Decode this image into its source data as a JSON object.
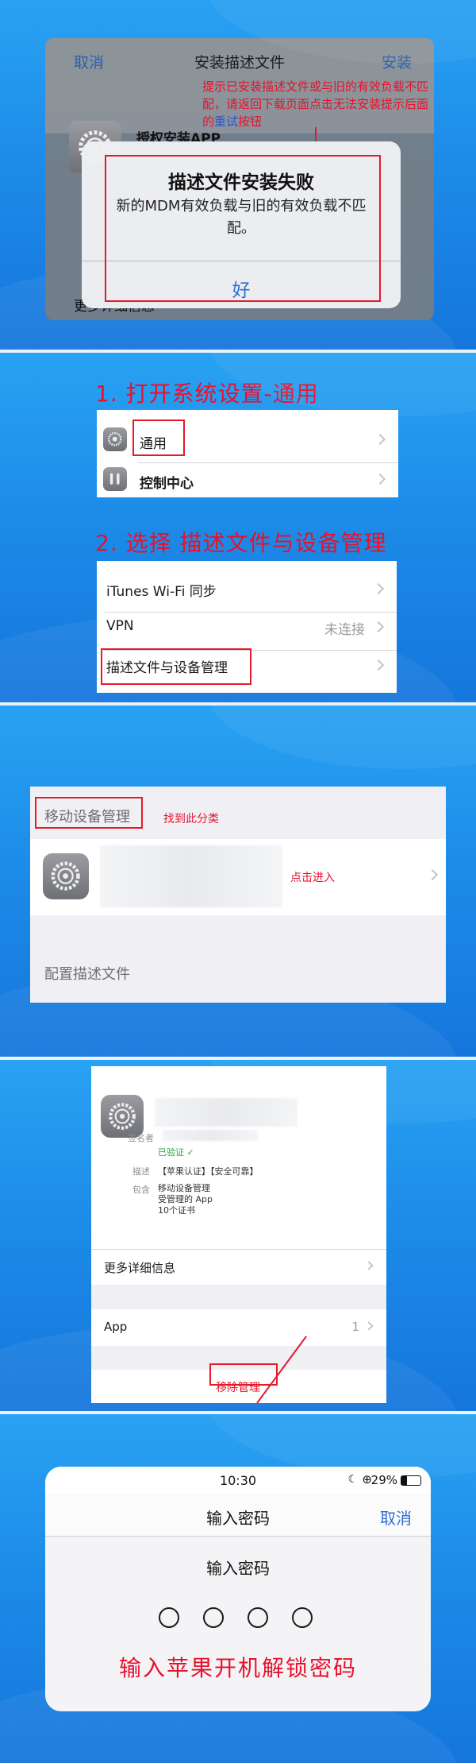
{
  "section1": {
    "cancel": "取消",
    "title": "安装描述文件",
    "install": "安装",
    "app_name": "授权安装APP",
    "more_info_partial": "更多详细信息",
    "note_part1": "提示已安装描述文件或与旧的有效负载不匹配，请返回下载页面点击无法安装提示后面的",
    "note_retry": "重试",
    "note_part2": "按钮",
    "alert": {
      "title": "描述文件安装失败",
      "message": "新的MDM有效负载与旧的有效负载不匹配。",
      "ok": "好"
    }
  },
  "section2": {
    "step1": "1. 打开系统设置-通用",
    "general": "通用",
    "control_center": "控制中心",
    "step2": "2. 选择 描述文件与设备管理",
    "itunes": "iTunes Wi-Fi 同步",
    "vpn": "VPN",
    "vpn_status": "未连接",
    "profiles": "描述文件与设备管理"
  },
  "section3": {
    "mdm_header": "移动设备管理",
    "find_hint": "找到此分类",
    "tap_hint": "点击进入",
    "config_header": "配置描述文件"
  },
  "section4": {
    "signer_label": "签名者",
    "verified": "已验证",
    "desc_label": "描述",
    "desc_value": "【苹果认证】【安全可靠】",
    "contains_label": "包含",
    "contains_values": [
      "移动设备管理",
      "受管理的 App",
      "10个证书"
    ],
    "more_info": "更多详细信息",
    "app_label": "App",
    "app_count": "1",
    "remove": "移除管理"
  },
  "section5": {
    "time": "10:30",
    "battery": "29%",
    "nav_title": "输入密码",
    "cancel": "取消",
    "prompt": "输入密码",
    "hint": "输入苹果开机解锁密码"
  },
  "colors": {
    "accent_red": "#e8112d",
    "ios_blue": "#2f6fd6",
    "background_blue": "#1f86e6"
  }
}
